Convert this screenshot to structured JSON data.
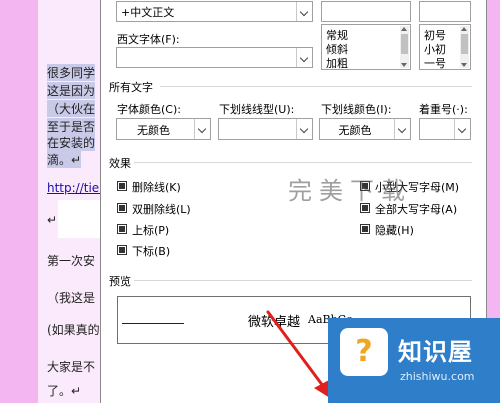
{
  "document": {
    "lines": [
      "很多同学",
      "这是因为",
      "（大伙在",
      "至于是否",
      "在安装的",
      "滴。↵",
      "http://tiel",
      "↵",
      "第一次安",
      "（我这是",
      "(如果真的",
      "大家是不",
      "了。↵"
    ]
  },
  "dialog": {
    "chinese_font_value": "+中文正文",
    "western_font_label": "西文字体(F):",
    "western_font_value": "",
    "style_list": [
      "常规",
      "倾斜",
      "加粗"
    ],
    "size_list": [
      "初号",
      "小初",
      "一号"
    ],
    "all_text_heading": "所有文字",
    "font_color_label": "字体颜色(C):",
    "font_color_value": "无颜色",
    "underline_type_label": "下划线线型(U):",
    "underline_type_value": "",
    "underline_color_label": "下划线颜色(I):",
    "underline_color_value": "无颜色",
    "emphasis_label": "着重号(·):",
    "emphasis_value": "",
    "effects_heading": "效果",
    "effects_left": [
      {
        "label": "删除线(K)"
      },
      {
        "label": "双删除线(L)"
      },
      {
        "label": "上标(P)"
      },
      {
        "label": "下标(B)"
      }
    ],
    "effects_right": [
      {
        "label": "小型大写字母(M)"
      },
      {
        "label": "全部大写字母(A)"
      },
      {
        "label": "隐藏(H)"
      }
    ],
    "preview_heading": "预览",
    "preview_text": "微软卓越",
    "preview_sample": "AaBbCc"
  },
  "watermark": "完美下载",
  "badge": {
    "title": "知识屋",
    "url": "zhishiwu.com",
    "icon": "question-icon"
  }
}
